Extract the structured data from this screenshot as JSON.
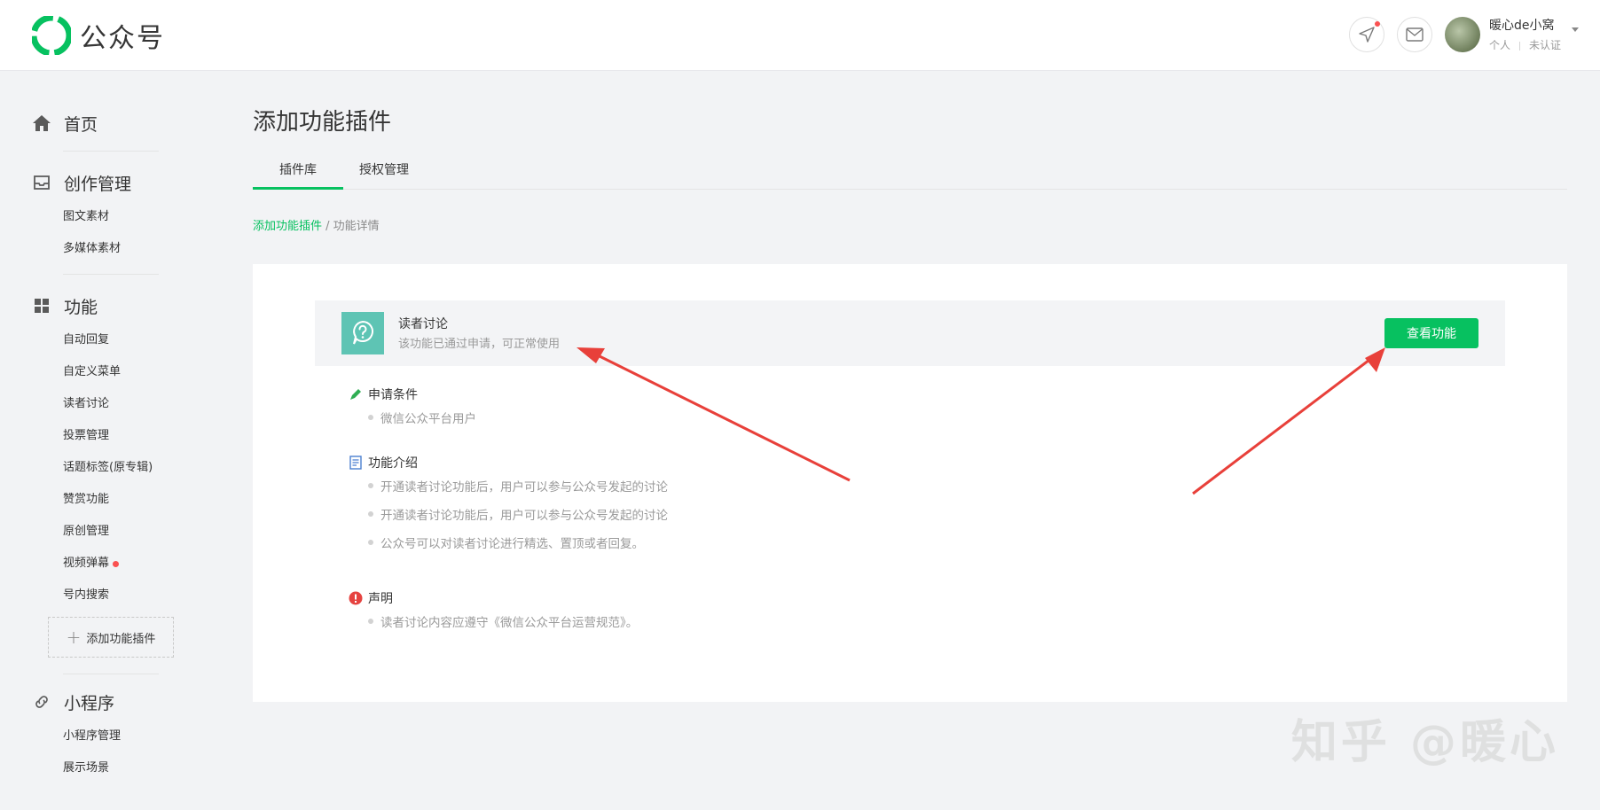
{
  "header": {
    "logo_text": "公众号",
    "user_name": "暖心de小窝",
    "user_type": "个人",
    "user_verify": "未认证"
  },
  "sidebar": {
    "home": "首页",
    "creation": {
      "title": "创作管理",
      "items": [
        "图文素材",
        "多媒体素材"
      ]
    },
    "features": {
      "title": "功能",
      "items": [
        "自动回复",
        "自定义菜单",
        "读者讨论",
        "投票管理",
        "话题标签(原专辑)",
        "赞赏功能",
        "原创管理",
        "视频弹幕",
        "号内搜索"
      ],
      "add_plugin": "添加功能插件"
    },
    "miniprogram": {
      "title": "小程序",
      "items": [
        "小程序管理",
        "展示场景"
      ]
    }
  },
  "main": {
    "title": "添加功能插件",
    "tabs": [
      "插件库",
      "授权管理"
    ],
    "breadcrumb": {
      "link": "添加功能插件",
      "sep": " / ",
      "current": "功能详情"
    },
    "plugin": {
      "name": "读者讨论",
      "status": "该功能已通过申请，可正常使用",
      "button": "查看功能"
    },
    "sections": {
      "conditions": {
        "title": "申请条件",
        "items": [
          "微信公众平台用户"
        ]
      },
      "intro": {
        "title": "功能介绍",
        "items": [
          "开通读者讨论功能后，用户可以参与公众号发起的讨论",
          "开通读者讨论功能后，用户可以参与公众号发起的讨论",
          "公众号可以对读者讨论进行精选、置顶或者回复。"
        ]
      },
      "statement": {
        "title": "声明",
        "items": [
          "读者讨论内容应遵守《微信公众平台运营规范》。"
        ]
      }
    }
  },
  "watermark": "知乎 @暖心",
  "colors": {
    "accent": "#07c160",
    "arrow": "#e8403a",
    "alert": "#e64340"
  }
}
